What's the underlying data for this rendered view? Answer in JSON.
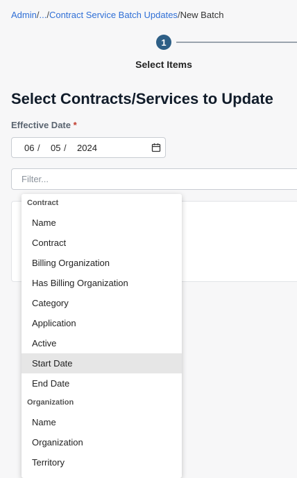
{
  "breadcrumb": {
    "admin": "Admin",
    "sep1": "/",
    "ellipsis": "...",
    "sep2": "/",
    "batch_updates": "Contract Service Batch Updates",
    "sep3": "/",
    "current": "New Batch"
  },
  "stepper": {
    "step_number": "1",
    "step_label": "Select Items"
  },
  "main": {
    "title": "Select Contracts/Services to Update",
    "effective_date_label": "Effective Date",
    "required_mark": "*",
    "date": {
      "month": "06",
      "day": "05",
      "year": "2024",
      "sep": "/"
    },
    "filter_placeholder": "Filter..."
  },
  "dropdown": {
    "groups": [
      {
        "header": "Contract",
        "options": [
          "Name",
          "Contract",
          "Billing Organization",
          "Has Billing Organization",
          "Category",
          "Application",
          "Active",
          "Start Date",
          "End Date"
        ]
      },
      {
        "header": "Organization",
        "options": [
          "Name",
          "Organization",
          "Territory"
        ]
      }
    ],
    "highlighted": "Start Date"
  },
  "icons": {
    "calendar": "calendar-icon"
  },
  "colors": {
    "link": "#2f6fd6",
    "step_active": "#2e5f86",
    "required": "#c0392b",
    "highlight": "#e6e6e6"
  }
}
